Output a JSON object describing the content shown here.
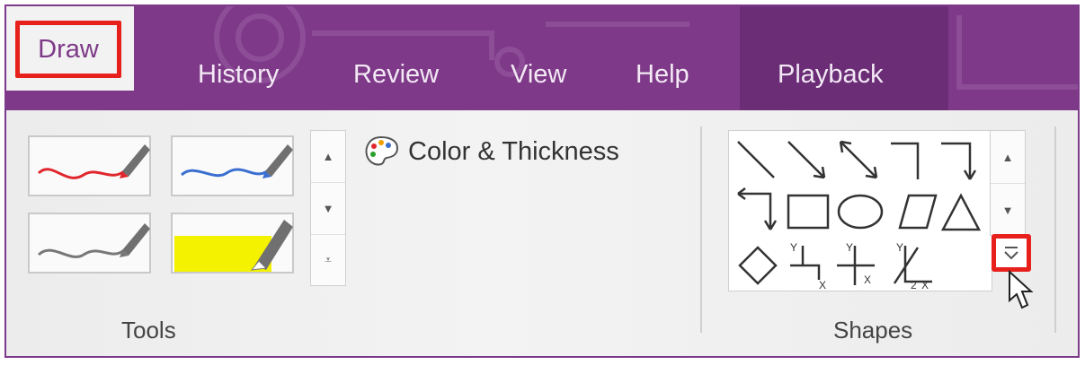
{
  "tabs": {
    "draw": "Draw",
    "history": "History",
    "review": "Review",
    "view": "View",
    "help": "Help",
    "playback": "Playback"
  },
  "tools": {
    "color_thickness": "Color & Thickness",
    "group_label": "Tools",
    "pens": [
      {
        "name": "red-pen",
        "color": "#e0262c"
      },
      {
        "name": "blue-pen",
        "color": "#3a6fd0"
      },
      {
        "name": "gray-pen",
        "color": "#777777"
      },
      {
        "name": "yellow-highlighter",
        "color": "#f5f200"
      }
    ]
  },
  "shapes": {
    "group_label": "Shapes"
  },
  "colors": {
    "accent": "#7e3a88",
    "highlight": "#e8201c"
  }
}
